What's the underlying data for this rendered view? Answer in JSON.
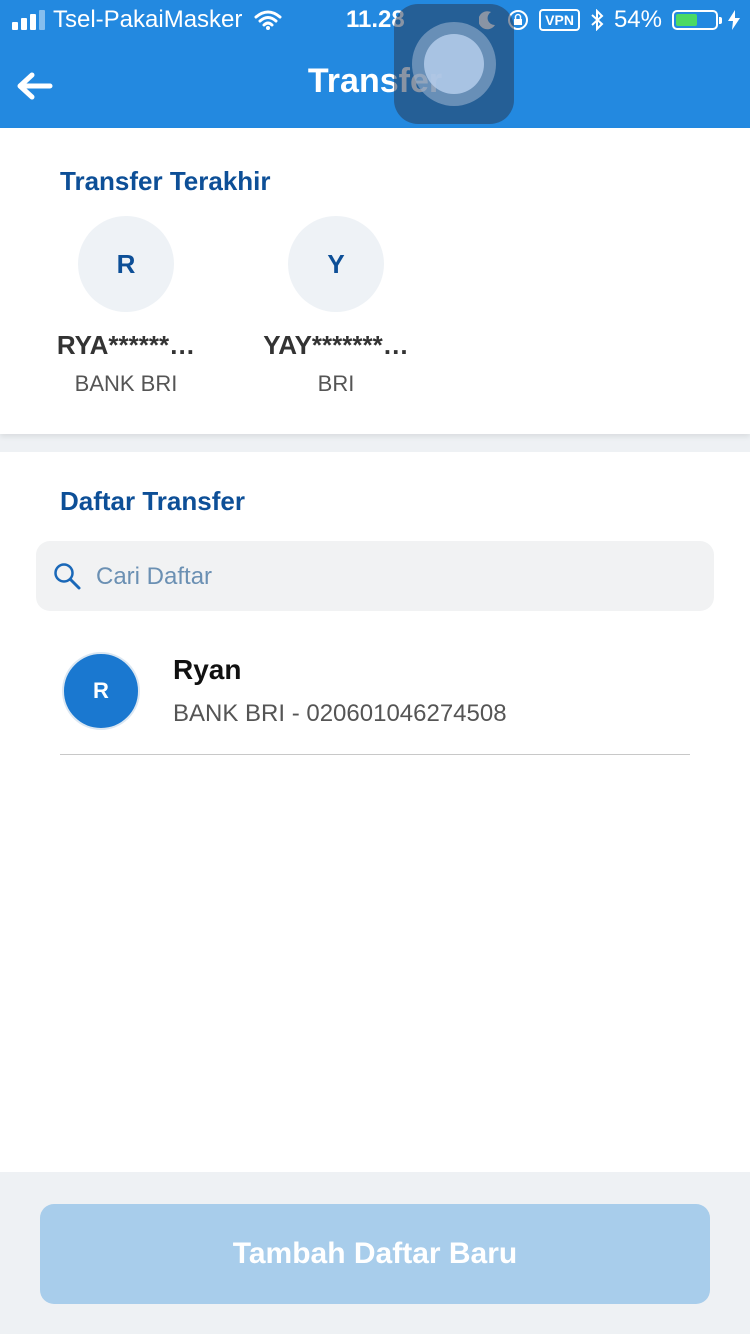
{
  "status_bar": {
    "carrier": "Tsel-PakaiMasker",
    "time": "11.28",
    "vpn": "VPN",
    "battery": "54%",
    "battery_level": 0.54
  },
  "header": {
    "title": "Transfer"
  },
  "recent": {
    "title": "Transfer Terakhir",
    "contacts": [
      {
        "initial": "R",
        "name": "RYA******…",
        "bank": "BANK BRI"
      },
      {
        "initial": "Y",
        "name": "YAY*******…",
        "bank": "BRI"
      }
    ]
  },
  "list": {
    "title": "Daftar Transfer",
    "search_placeholder": "Cari Daftar",
    "items": [
      {
        "initial": "R",
        "name": "Ryan",
        "detail": "BANK BRI - 020601046274508"
      }
    ]
  },
  "actions": {
    "add_label": "Tambah Daftar Baru"
  },
  "colors": {
    "primary": "#2389e0",
    "title_blue": "#0d4f97",
    "button_disabled": "#a8cdeb"
  }
}
